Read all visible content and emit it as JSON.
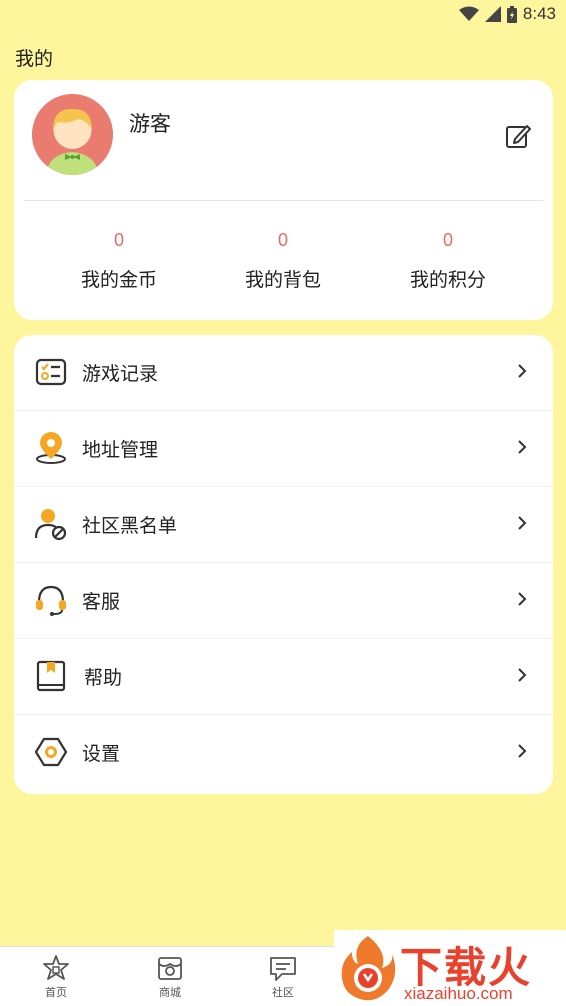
{
  "status_bar": {
    "time": "8:43"
  },
  "page_title": "我的",
  "profile": {
    "username": "游客",
    "stats": [
      {
        "value": "0",
        "label": "我的金币"
      },
      {
        "value": "0",
        "label": "我的背包"
      },
      {
        "value": "0",
        "label": "我的积分"
      }
    ]
  },
  "menu": [
    {
      "label": "游戏记录",
      "icon": "game-record-icon"
    },
    {
      "label": "地址管理",
      "icon": "location-pin-icon"
    },
    {
      "label": "社区黑名单",
      "icon": "user-block-icon"
    },
    {
      "label": "客服",
      "icon": "headset-icon"
    },
    {
      "label": "帮助",
      "icon": "help-book-icon"
    },
    {
      "label": "设置",
      "icon": "settings-hexagon-icon"
    }
  ],
  "tabs": [
    {
      "label": "首页",
      "icon": "home-icon"
    },
    {
      "label": "商城",
      "icon": "shop-icon"
    },
    {
      "label": "社区",
      "icon": "chat-icon"
    }
  ],
  "watermark": {
    "text": "下载火",
    "url": "xiazaihuo.com"
  },
  "colors": {
    "background": "#fff59d",
    "accent": "#f5a623",
    "stat_value": "#e96a5f",
    "watermark": "#e8412c"
  }
}
